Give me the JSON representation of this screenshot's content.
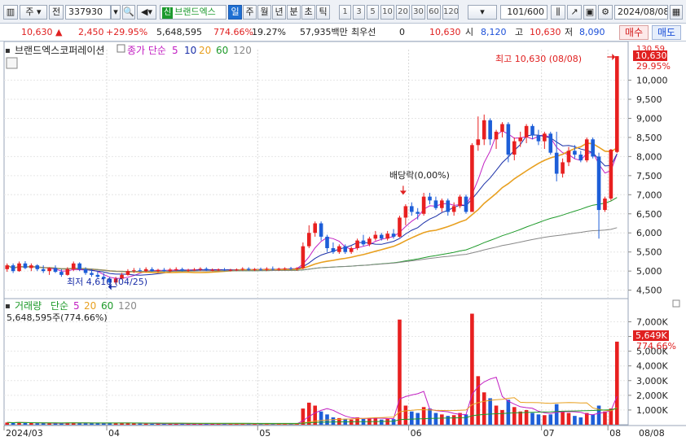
{
  "toolbar": {
    "period_type": "주",
    "market_type": "전",
    "code": "337930",
    "stock_badge": "신",
    "stock_name": "브랜드엑스",
    "periods": [
      "일",
      "주",
      "월",
      "년",
      "분",
      "초",
      "틱"
    ],
    "active_period": "일",
    "intervals": [
      "1",
      "3",
      "5",
      "10",
      "20",
      "30",
      "60",
      "120"
    ],
    "count": "101",
    "count_max": "/600",
    "date": "2024/08/08"
  },
  "quote": {
    "price": "10,630",
    "change": "2,450",
    "change_rate": "+29.95%",
    "volume": "5,648,595",
    "volume_rate": "774.66%",
    "turnover_rate": "19.27%",
    "amount": "57,935백만",
    "best_ask_label": "최우선",
    "best_ask": "0",
    "best_bid": "10,630",
    "open_label": "시",
    "open": "8,120",
    "high_label": "고",
    "high": "10,630",
    "low_label": "저",
    "low": "8,090",
    "buy_label": "매수",
    "sell_label": "매도"
  },
  "price_panel": {
    "legend_name": "브랜드엑스코퍼레이션",
    "legend_ma_label": "종가 단순",
    "legend_ma_periods": [
      "5",
      "10",
      "20",
      "60",
      "120"
    ],
    "high_note": "최고 10,630 (08/08)",
    "low_note": "최저 4,610 (04/25)",
    "dividend_note": "배당락(0,00%)",
    "right_tag_top": "130.59",
    "right_tag_price": "10,630",
    "right_tag_rate": "29.95%",
    "y_ticks": [
      "10,000",
      "9,500",
      "9,000",
      "8,500",
      "8,000",
      "7,500",
      "7,000",
      "6,500",
      "6,000",
      "5,500",
      "5,000",
      "4,500"
    ]
  },
  "volume_panel": {
    "legend_name": "거래량",
    "legend_ma_label": "단순",
    "legend_ma_periods": [
      "5",
      "20",
      "60",
      "120"
    ],
    "volume_note": "5,648,595주(774.66%)",
    "right_tag_volume": "5,649K",
    "right_tag_rate": "774.66%",
    "y_ticks": [
      "7,000K",
      "6,000K",
      "5,000K",
      "4,000K",
      "3,000K",
      "2,000K",
      "1,000K"
    ]
  },
  "x_axis": {
    "labels": [
      "2024/03",
      "04",
      "05",
      "06",
      "07",
      "08"
    ],
    "right_label": "08/08"
  },
  "colors": {
    "up": "#e82020",
    "down": "#1d5ed8",
    "ma5": "#c21fc2",
    "ma10": "#1a2fa8",
    "ma20": "#e8a020",
    "ma60": "#1e9a2a",
    "ma120": "#888888",
    "grid": "#e6e6e6"
  },
  "chart_data": {
    "type": "candlestick",
    "title": "브랜드엑스코퍼레이션",
    "ylim_price": [
      4300,
      10800
    ],
    "ylim_volume": [
      0,
      7800000
    ],
    "candles": [
      {
        "o": 5050,
        "h": 5200,
        "l": 4980,
        "c": 5150,
        "v": 150000
      },
      {
        "o": 5150,
        "h": 5200,
        "l": 4950,
        "c": 5000,
        "v": 130000
      },
      {
        "o": 5000,
        "h": 5250,
        "l": 4980,
        "c": 5200,
        "v": 170000
      },
      {
        "o": 5200,
        "h": 5260,
        "l": 5050,
        "c": 5080,
        "v": 120000
      },
      {
        "o": 5080,
        "h": 5200,
        "l": 5000,
        "c": 5150,
        "v": 110000
      },
      {
        "o": 5150,
        "h": 5180,
        "l": 5000,
        "c": 5050,
        "v": 100000
      },
      {
        "o": 5050,
        "h": 5150,
        "l": 4950,
        "c": 5000,
        "v": 110000
      },
      {
        "o": 5000,
        "h": 5100,
        "l": 4900,
        "c": 5080,
        "v": 100000
      },
      {
        "o": 5080,
        "h": 5150,
        "l": 4950,
        "c": 4980,
        "v": 90000
      },
      {
        "o": 4980,
        "h": 5050,
        "l": 4850,
        "c": 4900,
        "v": 100000
      },
      {
        "o": 4900,
        "h": 5100,
        "l": 4880,
        "c": 5050,
        "v": 130000
      },
      {
        "o": 5050,
        "h": 5250,
        "l": 5000,
        "c": 5200,
        "v": 150000
      },
      {
        "o": 5200,
        "h": 5230,
        "l": 5000,
        "c": 5050,
        "v": 110000
      },
      {
        "o": 5050,
        "h": 5100,
        "l": 4900,
        "c": 4950,
        "v": 100000
      },
      {
        "o": 4950,
        "h": 5050,
        "l": 4850,
        "c": 4900,
        "v": 90000
      },
      {
        "o": 4900,
        "h": 5000,
        "l": 4820,
        "c": 4850,
        "v": 100000
      },
      {
        "o": 4850,
        "h": 4950,
        "l": 4750,
        "c": 4800,
        "v": 120000
      },
      {
        "o": 4800,
        "h": 4850,
        "l": 4610,
        "c": 4700,
        "v": 140000
      },
      {
        "o": 4700,
        "h": 4850,
        "l": 4650,
        "c": 4800,
        "v": 110000
      },
      {
        "o": 4800,
        "h": 4950,
        "l": 4780,
        "c": 4900,
        "v": 100000
      },
      {
        "o": 4900,
        "h": 5050,
        "l": 4880,
        "c": 5000,
        "v": 110000
      },
      {
        "o": 5000,
        "h": 5080,
        "l": 4950,
        "c": 5020,
        "v": 90000
      },
      {
        "o": 5020,
        "h": 5080,
        "l": 4980,
        "c": 5000,
        "v": 80000
      },
      {
        "o": 5000,
        "h": 5100,
        "l": 4970,
        "c": 5050,
        "v": 80000
      },
      {
        "o": 5050,
        "h": 5100,
        "l": 4980,
        "c": 5000,
        "v": 70000
      },
      {
        "o": 5000,
        "h": 5060,
        "l": 4960,
        "c": 5030,
        "v": 70000
      },
      {
        "o": 5030,
        "h": 5080,
        "l": 4980,
        "c": 5000,
        "v": 60000
      },
      {
        "o": 5000,
        "h": 5080,
        "l": 4970,
        "c": 5040,
        "v": 70000
      },
      {
        "o": 5040,
        "h": 5100,
        "l": 5000,
        "c": 5050,
        "v": 60000
      },
      {
        "o": 5050,
        "h": 5090,
        "l": 4990,
        "c": 5010,
        "v": 60000
      },
      {
        "o": 5010,
        "h": 5060,
        "l": 4980,
        "c": 5030,
        "v": 60000
      },
      {
        "o": 5030,
        "h": 5080,
        "l": 5000,
        "c": 5040,
        "v": 60000
      },
      {
        "o": 5040,
        "h": 5100,
        "l": 5000,
        "c": 5060,
        "v": 70000
      },
      {
        "o": 5060,
        "h": 5100,
        "l": 5000,
        "c": 5020,
        "v": 60000
      },
      {
        "o": 5020,
        "h": 5070,
        "l": 4990,
        "c": 5030,
        "v": 60000
      },
      {
        "o": 5030,
        "h": 5070,
        "l": 5000,
        "c": 5040,
        "v": 60000
      },
      {
        "o": 5040,
        "h": 5080,
        "l": 5000,
        "c": 5020,
        "v": 60000
      },
      {
        "o": 5020,
        "h": 5060,
        "l": 4990,
        "c": 5030,
        "v": 60000
      },
      {
        "o": 5030,
        "h": 5070,
        "l": 5000,
        "c": 5040,
        "v": 60000
      },
      {
        "o": 5040,
        "h": 5100,
        "l": 5010,
        "c": 5060,
        "v": 70000
      },
      {
        "o": 5060,
        "h": 5100,
        "l": 5010,
        "c": 5030,
        "v": 60000
      },
      {
        "o": 5030,
        "h": 5080,
        "l": 5000,
        "c": 5050,
        "v": 60000
      },
      {
        "o": 5050,
        "h": 5090,
        "l": 5010,
        "c": 5040,
        "v": 60000
      },
      {
        "o": 5040,
        "h": 5100,
        "l": 5000,
        "c": 5060,
        "v": 70000
      },
      {
        "o": 5060,
        "h": 5120,
        "l": 5020,
        "c": 5050,
        "v": 60000
      },
      {
        "o": 5050,
        "h": 5090,
        "l": 5010,
        "c": 5060,
        "v": 60000
      },
      {
        "o": 5060,
        "h": 5100,
        "l": 5020,
        "c": 5070,
        "v": 60000
      },
      {
        "o": 5070,
        "h": 5110,
        "l": 5030,
        "c": 5060,
        "v": 60000
      },
      {
        "o": 5060,
        "h": 5100,
        "l": 5010,
        "c": 5080,
        "v": 70000
      },
      {
        "o": 5080,
        "h": 5750,
        "l": 5050,
        "c": 5650,
        "v": 1100000
      },
      {
        "o": 5650,
        "h": 6200,
        "l": 5600,
        "c": 6000,
        "v": 1500000
      },
      {
        "o": 6000,
        "h": 6300,
        "l": 5900,
        "c": 6250,
        "v": 1300000
      },
      {
        "o": 6250,
        "h": 6300,
        "l": 5800,
        "c": 5900,
        "v": 900000
      },
      {
        "o": 5900,
        "h": 5950,
        "l": 5500,
        "c": 5600,
        "v": 700000
      },
      {
        "o": 5600,
        "h": 5750,
        "l": 5450,
        "c": 5500,
        "v": 500000
      },
      {
        "o": 5500,
        "h": 5700,
        "l": 5450,
        "c": 5650,
        "v": 450000
      },
      {
        "o": 5650,
        "h": 5700,
        "l": 5450,
        "c": 5500,
        "v": 400000
      },
      {
        "o": 5500,
        "h": 5650,
        "l": 5450,
        "c": 5600,
        "v": 350000
      },
      {
        "o": 5600,
        "h": 5850,
        "l": 5550,
        "c": 5800,
        "v": 500000
      },
      {
        "o": 5800,
        "h": 5950,
        "l": 5650,
        "c": 5700,
        "v": 400000
      },
      {
        "o": 5700,
        "h": 5900,
        "l": 5650,
        "c": 5850,
        "v": 450000
      },
      {
        "o": 5850,
        "h": 6050,
        "l": 5800,
        "c": 5950,
        "v": 500000
      },
      {
        "o": 5950,
        "h": 6000,
        "l": 5800,
        "c": 5850,
        "v": 350000
      },
      {
        "o": 5850,
        "h": 6050,
        "l": 5800,
        "c": 5980,
        "v": 400000
      },
      {
        "o": 5980,
        "h": 6100,
        "l": 5850,
        "c": 5900,
        "v": 380000
      },
      {
        "o": 5900,
        "h": 6450,
        "l": 5880,
        "c": 6400,
        "v": 7150000
      },
      {
        "o": 6400,
        "h": 6750,
        "l": 6200,
        "c": 6700,
        "v": 1300000
      },
      {
        "o": 6700,
        "h": 6800,
        "l": 6450,
        "c": 6550,
        "v": 900000
      },
      {
        "o": 6550,
        "h": 6650,
        "l": 6350,
        "c": 6500,
        "v": 800000
      },
      {
        "o": 6500,
        "h": 7050,
        "l": 6450,
        "c": 6950,
        "v": 1200000
      },
      {
        "o": 6950,
        "h": 7050,
        "l": 6750,
        "c": 6850,
        "v": 1100000
      },
      {
        "o": 6850,
        "h": 6950,
        "l": 6600,
        "c": 6650,
        "v": 800000
      },
      {
        "o": 6650,
        "h": 6900,
        "l": 6550,
        "c": 6850,
        "v": 700000
      },
      {
        "o": 6850,
        "h": 6900,
        "l": 6450,
        "c": 6550,
        "v": 600000
      },
      {
        "o": 6550,
        "h": 6800,
        "l": 6450,
        "c": 6700,
        "v": 650000
      },
      {
        "o": 6700,
        "h": 7000,
        "l": 6650,
        "c": 6950,
        "v": 800000
      },
      {
        "o": 6950,
        "h": 7000,
        "l": 6500,
        "c": 6550,
        "v": 700000
      },
      {
        "o": 6550,
        "h": 8350,
        "l": 6550,
        "c": 8300,
        "v": 7550000
      },
      {
        "o": 8300,
        "h": 9050,
        "l": 8150,
        "c": 8450,
        "v": 3300000
      },
      {
        "o": 8450,
        "h": 9100,
        "l": 8300,
        "c": 8950,
        "v": 2200000
      },
      {
        "o": 8950,
        "h": 9000,
        "l": 8300,
        "c": 8450,
        "v": 1800000
      },
      {
        "o": 8450,
        "h": 8700,
        "l": 8200,
        "c": 8650,
        "v": 1300000
      },
      {
        "o": 8650,
        "h": 8900,
        "l": 8500,
        "c": 8850,
        "v": 1000000
      },
      {
        "o": 8850,
        "h": 8900,
        "l": 7850,
        "c": 8050,
        "v": 1700000
      },
      {
        "o": 8050,
        "h": 8500,
        "l": 7900,
        "c": 8400,
        "v": 1200000
      },
      {
        "o": 8400,
        "h": 8650,
        "l": 8250,
        "c": 8500,
        "v": 900000
      },
      {
        "o": 8500,
        "h": 8850,
        "l": 8350,
        "c": 8800,
        "v": 1000000
      },
      {
        "o": 8800,
        "h": 8850,
        "l": 8450,
        "c": 8550,
        "v": 800000
      },
      {
        "o": 8550,
        "h": 8700,
        "l": 8300,
        "c": 8400,
        "v": 700000
      },
      {
        "o": 8400,
        "h": 8650,
        "l": 8200,
        "c": 8600,
        "v": 650000
      },
      {
        "o": 8600,
        "h": 8650,
        "l": 8050,
        "c": 8100,
        "v": 700000
      },
      {
        "o": 8100,
        "h": 8650,
        "l": 7350,
        "c": 7550,
        "v": 1400000
      },
      {
        "o": 7550,
        "h": 7950,
        "l": 7450,
        "c": 7850,
        "v": 900000
      },
      {
        "o": 7850,
        "h": 8250,
        "l": 7750,
        "c": 8150,
        "v": 800000
      },
      {
        "o": 8150,
        "h": 8300,
        "l": 7950,
        "c": 8050,
        "v": 600000
      },
      {
        "o": 8050,
        "h": 8150,
        "l": 7850,
        "c": 7900,
        "v": 500000
      },
      {
        "o": 7900,
        "h": 8500,
        "l": 7850,
        "c": 8450,
        "v": 800000
      },
      {
        "o": 8450,
        "h": 8500,
        "l": 7950,
        "c": 8000,
        "v": 700000
      },
      {
        "o": 8000,
        "h": 8100,
        "l": 5850,
        "c": 6600,
        "v": 1300000
      },
      {
        "o": 6600,
        "h": 6950,
        "l": 6550,
        "c": 6900,
        "v": 900000
      },
      {
        "o": 6900,
        "h": 8200,
        "l": 6850,
        "c": 8180,
        "v": 1100000
      },
      {
        "o": 8120,
        "h": 10630,
        "l": 8090,
        "c": 10630,
        "v": 5648595
      }
    ]
  }
}
